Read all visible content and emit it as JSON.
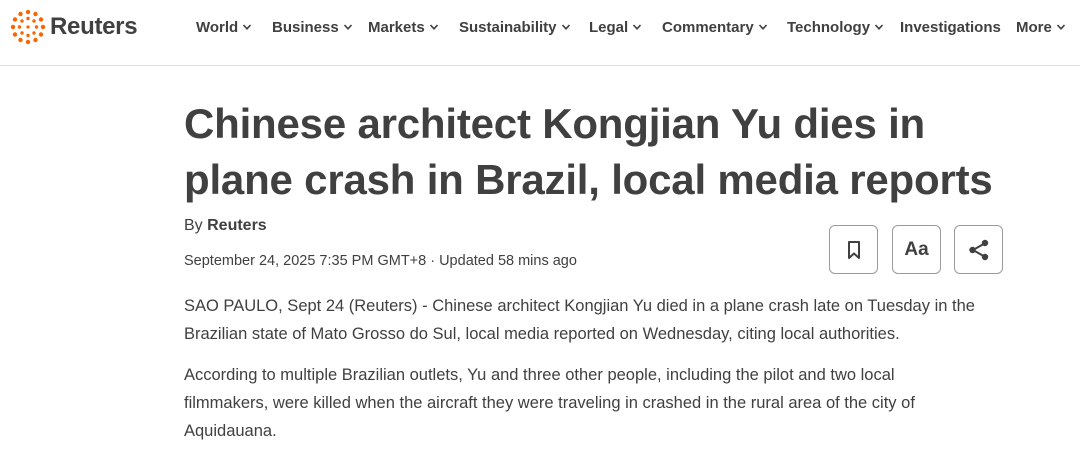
{
  "brand": {
    "name": "Reuters",
    "color": "#fa6400"
  },
  "nav": {
    "items": [
      {
        "label": "World",
        "has_dropdown": true
      },
      {
        "label": "Business",
        "has_dropdown": true
      },
      {
        "label": "Markets",
        "has_dropdown": true
      },
      {
        "label": "Sustainability",
        "has_dropdown": true
      },
      {
        "label": "Legal",
        "has_dropdown": true
      },
      {
        "label": "Commentary",
        "has_dropdown": true
      },
      {
        "label": "Technology",
        "has_dropdown": true
      },
      {
        "label": "Investigations",
        "has_dropdown": false
      },
      {
        "label": "More",
        "has_dropdown": true
      }
    ]
  },
  "article": {
    "headline_line1": "Chinese architect Kongjian Yu dies in",
    "headline_line2": "plane crash in Brazil, local media reports",
    "byline_prefix": "By",
    "author": "Reuters",
    "dateline": "September 24, 2025 7:35 PM GMT+8 · Updated 58 mins ago",
    "paragraphs": [
      {
        "line1": "SAO PAULO, Sept 24 (Reuters) - Chinese architect Kongjian Yu died in a plane crash late on Tuesday in the",
        "line2": "Brazilian state of Mato Grosso do Sul, local media reported on Wednesday, citing local authorities."
      },
      {
        "line1": "According to multiple Brazilian outlets, Yu and three other people, including the pilot and two local",
        "line2": "filmmakers, were killed when the aircraft they were traveling in crashed in the rural area of the city of",
        "line3": "Aquidauana."
      }
    ]
  },
  "actions": {
    "bookmark_icon": "bookmark-icon",
    "text_size_label": "Aa",
    "share_icon": "share-icon"
  },
  "colors": {
    "text": "#404040",
    "border": "#9a9a9a",
    "divider": "#e0e0e0"
  }
}
